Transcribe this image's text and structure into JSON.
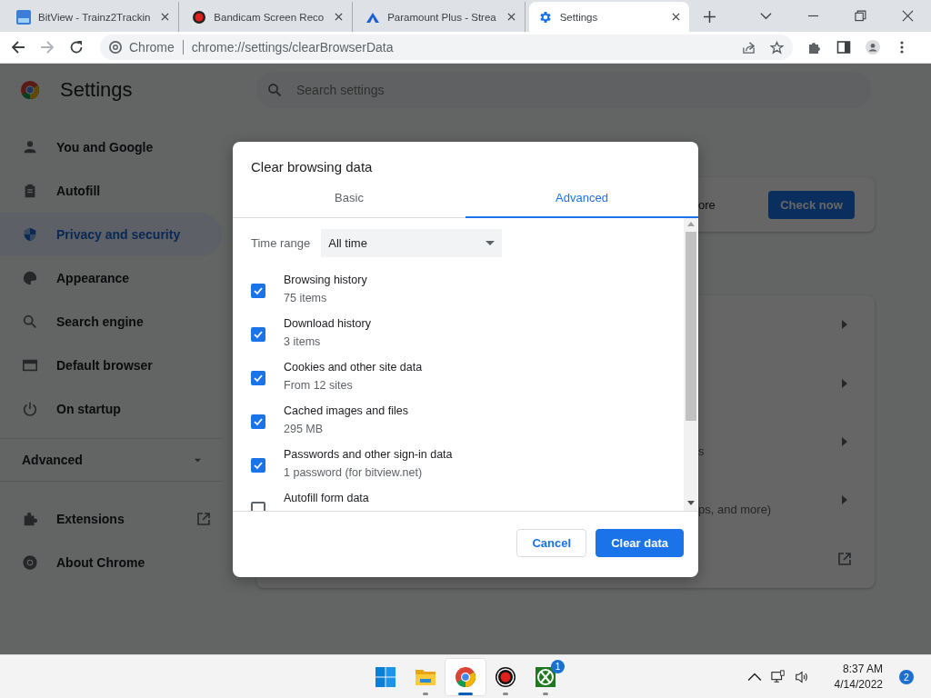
{
  "browser": {
    "tabs": [
      {
        "title": "BitView - Trainz2Trackin",
        "selected": false
      },
      {
        "title": "Bandicam Screen Reco",
        "selected": false
      },
      {
        "title": "Paramount Plus - Strea",
        "selected": false
      },
      {
        "title": "Settings",
        "selected": true
      }
    ],
    "address_bar": {
      "site": "Chrome",
      "url": "chrome://settings/clearBrowserData"
    }
  },
  "settings": {
    "title": "Settings",
    "search": {
      "placeholder": "Search settings"
    },
    "sidebar": {
      "items": [
        {
          "label": "You and Google",
          "selected": false
        },
        {
          "label": "Autofill",
          "selected": false
        },
        {
          "label": "Privacy and security",
          "selected": true
        },
        {
          "label": "Appearance",
          "selected": false
        },
        {
          "label": "Search engine",
          "selected": false
        },
        {
          "label": "Default browser",
          "selected": false
        },
        {
          "label": "On startup",
          "selected": false
        }
      ],
      "advanced": {
        "label": "Advanced",
        "expanded": false
      },
      "links": [
        {
          "label": "Extensions",
          "external": true
        },
        {
          "label": "About Chrome",
          "external": false
        }
      ]
    },
    "safety_card": {
      "text": "ore",
      "button": "Check now"
    },
    "rows": [
      {
        "kind": "arrow"
      },
      {
        "kind": "arrow"
      },
      {
        "kind": "arrow",
        "subtext": "s"
      },
      {
        "kind": "arrow",
        "subtext": "ps, and more)"
      },
      {
        "kind": "external"
      }
    ]
  },
  "dialog": {
    "title": "Clear browsing data",
    "tabs": [
      {
        "label": "Basic",
        "selected": false
      },
      {
        "label": "Advanced",
        "selected": true
      }
    ],
    "time_range": {
      "label": "Time range",
      "value": "All time"
    },
    "options": [
      {
        "label": "Browsing history",
        "detail": "75 items",
        "checked": true
      },
      {
        "label": "Download history",
        "detail": "3 items",
        "checked": true
      },
      {
        "label": "Cookies and other site data",
        "detail": "From 12 sites",
        "checked": true
      },
      {
        "label": "Cached images and files",
        "detail": "295 MB",
        "checked": true
      },
      {
        "label": "Passwords and other sign-in data",
        "detail": "1 password (for bitview.net)",
        "checked": true
      },
      {
        "label": "Autofill form data",
        "checked": false
      }
    ],
    "buttons": [
      {
        "label": "Cancel",
        "kind": "secondary"
      },
      {
        "label": "Clear data",
        "kind": "primary"
      }
    ]
  },
  "taskbar": {
    "apps": [
      {
        "running": false,
        "selected": false
      },
      {
        "running": true,
        "selected": false
      },
      {
        "running": true,
        "selected": true
      },
      {
        "running": true,
        "selected": false
      },
      {
        "running": true,
        "selected": false,
        "badge": "1"
      }
    ],
    "time": "8:37 AM",
    "date": "4/14/2022",
    "notifications": "2"
  }
}
